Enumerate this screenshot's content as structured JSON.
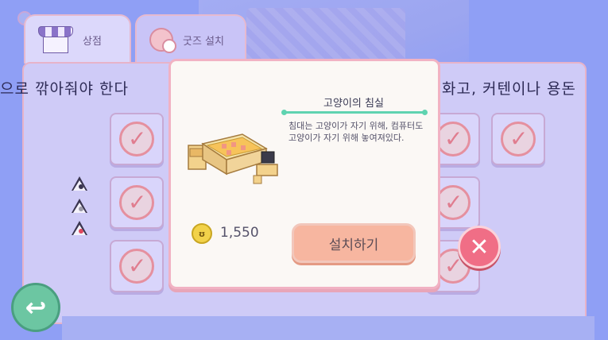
{
  "tabs": [
    {
      "label": "상점",
      "icon": "shop-icon"
    },
    {
      "label": "굿즈 설치",
      "icon": "goods-ball-icon"
    }
  ],
  "marquee": {
    "left_text": "으로 깎아줘야 한다",
    "right_text": "화고,  커텐이나 용돈"
  },
  "dialog": {
    "title": "고양이의 침실",
    "description": "침대는 고양이가 자기 위해, 컴퓨터도 고양이가 자기 위해 놓여져있다.",
    "price": "1,550",
    "install_label": "설치하기",
    "item_icon": "cat-bed-computer-furniture"
  },
  "colors": {
    "accent_teal": "#5fd3b0",
    "dialog_border": "#f1b2c3",
    "install_button": "#f7b6a0",
    "close_button": "#f06e86",
    "back_button": "#6cc6a2"
  }
}
